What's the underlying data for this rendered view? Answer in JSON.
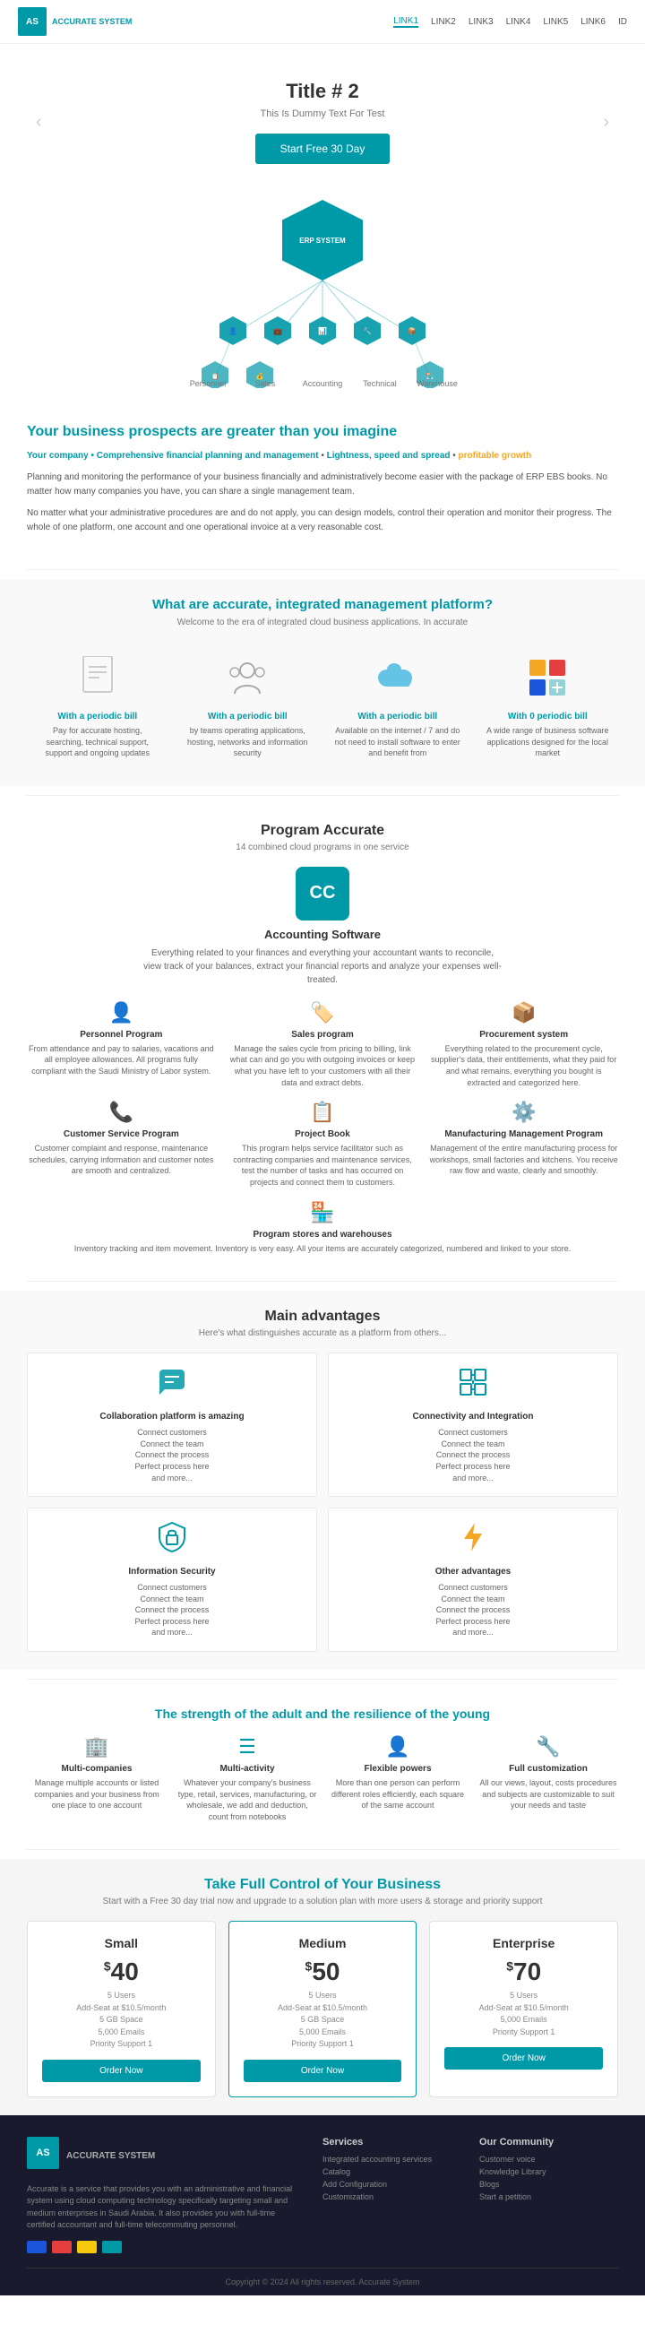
{
  "nav": {
    "logo_line1": "AS",
    "logo_line2": "ACCURATE SYSTEM",
    "links": [
      "LINK1",
      "LINK2",
      "LINK3",
      "LINK4",
      "LINK5",
      "LINK6",
      "ID"
    ],
    "active_link": 0
  },
  "hero": {
    "title": "Title # 2",
    "subtitle": "This Is Dummy Text For Test",
    "cta_button": "Start Free 30 Day"
  },
  "erp": {
    "center_label": "ERP SYSTEM"
  },
  "about": {
    "heading1": "Your business prospects are greater than you imagine",
    "highlight1": "Comprehensive financial planning and management",
    "highlight2": "Lightness, speed and spread",
    "highlight3": "profitable growth",
    "sub_heading": "Your company •",
    "para1": "Planning and monitoring the performance of your business financially and administratively become easier with the package of ERP EBS books. No matter how many companies you have, you can share a single management team.",
    "para2": "No matter what your administrative procedures are and do not apply, you can design models, control their operation and monitor their progress. The whole of one platform, one account and one operational invoice at a very reasonable cost."
  },
  "platform": {
    "heading": "What are accurate, integrated management platform?",
    "sub": "Welcome to the era of integrated cloud business applications. In accurate",
    "cards": [
      {
        "icon": "📄",
        "title": "With a periodic bill",
        "desc": "Pay for accurate hosting, searching, technical support, support and ongoing updates",
        "icon_type": "document"
      },
      {
        "icon": "👥",
        "title": "With a periodic bill",
        "desc": "by teams operating applications, hosting, networks and information security",
        "icon_type": "team"
      },
      {
        "icon": "☁️",
        "title": "With a periodic bill",
        "desc": "Available on the internet / 7 and do not need to install software to enter and benefit from",
        "icon_type": "cloud"
      },
      {
        "icon": "🟦",
        "title": "With 0 periodic bill",
        "desc": "A wide range of business software applications designed for the local market",
        "icon_type": "apps"
      }
    ]
  },
  "program": {
    "heading": "Program Accurate",
    "sub": "14 combined cloud programs in one service",
    "main": {
      "icon_label": "CC",
      "title": "Accounting Software",
      "desc": "Everything related to your finances and everything your accountant wants to reconcile, view track of your balances, extract your financial reports and analyze your expenses well-treated."
    },
    "items": [
      {
        "icon": "👤",
        "title": "Personnel Program",
        "desc": "From attendance and pay to salaries, vacations and all employee allowances. All programs fully compliant with the Saudi Ministry of Labor system."
      },
      {
        "icon": "🏷️",
        "title": "Sales program",
        "desc": "Manage the sales cycle from pricing to billing, link what can and go you with outgoing invoices or keep what you have left to your customers with all their data and extract debts."
      },
      {
        "icon": "📦",
        "title": "Procurement system",
        "desc": "Everything related to the procurement cycle, supplier's data, their entitlements, what they paid for and what remains, everything you bought is extracted and categorized here."
      },
      {
        "icon": "📞",
        "title": "Customer Service Program",
        "desc": "Customer complaint and response, maintenance schedules, carrying information and customer notes are smooth and centralized."
      },
      {
        "icon": "📋",
        "title": "Project Book",
        "desc": "This program helps service facilitator such as contracting companies and maintenance services, test the number of tasks and has occurred on projects and connect them to customers."
      },
      {
        "icon": "⚙️",
        "title": "Manufacturing Management Program",
        "desc": "Management of the entire manufacturing process for workshops, small factories and kitchens. You receive raw flow and waste, clearly and smoothly."
      },
      {
        "icon": "🏪",
        "title": "Program stores and warehouses",
        "desc": "Inventory tracking and item movement. Inventory is very easy. All your items are accurately categorized, numbered and linked to your store."
      }
    ]
  },
  "advantages": {
    "heading": "Main advantages",
    "sub": "Here's what distinguishes accurate as a platform from others...",
    "items": [
      {
        "icon": "💬",
        "title": "Collaboration platform is amazing",
        "desc": "Connect customers\nConnect the team\nConnect the process\nPerfect process here\nand more...",
        "icon_type": "chat"
      },
      {
        "icon": "🔌",
        "title": "Connectivity and Integration",
        "desc": "Connect customers\nConnect the team\nConnect the process\nPerfect process here\nand more...",
        "icon_type": "puzzle"
      },
      {
        "icon": "🔒",
        "title": "Information Security",
        "desc": "Connect customers\nConnect the team\nConnect the process\nPerfect process here\nand more...",
        "icon_type": "lock"
      },
      {
        "icon": "⚡",
        "title": "Other advantages",
        "desc": "Connect customers\nConnect the team\nConnect the process\nPerfect process here\nand more...",
        "icon_type": "lightning"
      }
    ]
  },
  "strength": {
    "heading": "The strength of the adult and the resilience of the young",
    "items": [
      {
        "icon": "🏢",
        "title": "Multi-companies",
        "desc": "Manage multiple accounts or listed companies and your business from one place to one account"
      },
      {
        "icon": "☰",
        "title": "Multi-activity",
        "desc": "Whatever your company's business type, retail, services, manufacturing, or wholesale, we add and deduction, count from notebooks"
      },
      {
        "icon": "👤",
        "title": "Flexible powers",
        "desc": "More than one person can perform different roles efficiently, each square of the same account"
      },
      {
        "icon": "🔧",
        "title": "Full customization",
        "desc": "All our views, layout, costs procedures and subjects are customizable to suit your needs and taste"
      }
    ]
  },
  "pricing": {
    "heading": "Take Full Control of Your Business",
    "sub": "Start with a Free 30 day trial now and upgrade to a solution plan with more users & storage and priority support",
    "plans": [
      {
        "name": "Small",
        "price": "40",
        "currency": "$",
        "desc": "5 Users\nAdd-Seat at $10.5/month\n5 GB Space\n5,000 Emails\nPriority Support 1",
        "btn": "Order Now",
        "featured": false
      },
      {
        "name": "Medium",
        "price": "50",
        "currency": "$",
        "desc": "5 Users\nAdd-Seat at $10.5/month\n5 GB Space\n5,000 Emails\nPriority Support 1",
        "btn": "Order Now",
        "featured": true
      },
      {
        "name": "Enterprise",
        "price": "70",
        "currency": "$",
        "desc": "5 Users\nAdd-Seat at $10.5/month\n5,000 Emails\nPriority Support 1",
        "btn": "Order Now",
        "featured": false
      }
    ]
  },
  "footer": {
    "logo_text": "AS",
    "brand_name": "ACCURATE SYSTEM",
    "brand_desc": "Accurate is a service that provides you with an administrative and financial system using cloud computing technology specifically targeting small and medium enterprises in Saudi Arabia. It also provides you with full-time certified accountant and full-time telecommuting personnel.",
    "services_heading": "Services",
    "services_links": [
      "Integrated accounting services",
      "Catalog",
      "Add Configuration",
      "Customization"
    ],
    "support_heading": "Our Community",
    "support_links": [
      "Customer voice",
      "Knowledge Library",
      "Blogs",
      "Start a petition"
    ],
    "copyright": "Copyright © 2024 All rights reserved. Accurate System"
  }
}
